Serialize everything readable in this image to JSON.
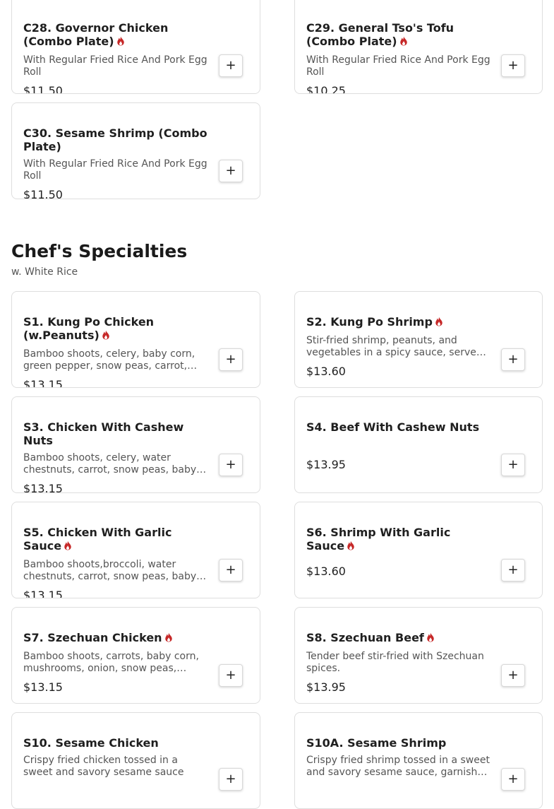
{
  "colors": {
    "spicy": "#c62828",
    "border": "#dedede",
    "text": "#1f1f1f",
    "muted": "#555555"
  },
  "add_button": {
    "label": "+",
    "icon": "plus-icon"
  },
  "combo": {
    "items": [
      {
        "title": "C28. Governor Chicken (Combo Plate)",
        "spicy": true,
        "desc": "With Regular Fried Rice And Pork Egg Roll",
        "price": "$11.50"
      },
      {
        "title": "C29. General Tso's Tofu (Combo Plate)",
        "spicy": true,
        "desc": "With Regular Fried Rice And Pork Egg Roll",
        "price": "$10.25"
      },
      {
        "title": "C30. Sesame Shrimp (Combo Plate)",
        "spicy": false,
        "desc": "With Regular Fried Rice And Pork Egg Roll",
        "price": "$11.50"
      }
    ]
  },
  "chef": {
    "title": "Chef's Specialties",
    "subtitle": "w. White Rice",
    "items": [
      {
        "title": "S1. Kung Po Chicken (w.Peanuts)",
        "spicy": true,
        "desc": "Bamboo shoots, celery, baby corn, green pepper, snow peas, carrot, and peanuts in a spicy sauce",
        "price": "$13.15"
      },
      {
        "title": "S2. Kung Po Shrimp",
        "spicy": true,
        "desc": "Stir-fried shrimp, peanuts, and vegetables in a spicy sauce, served with white rice",
        "price": "$13.60"
      },
      {
        "title": "S3. Chicken With Cashew Nuts",
        "spicy": false,
        "desc": "Bamboo shoots, celery, water chestnuts, carrot, snow peas, baby corn and cashew nuts",
        "price": "$13.15"
      },
      {
        "title": "S4. Beef With Cashew Nuts",
        "spicy": false,
        "desc": "",
        "price": "$13.95"
      },
      {
        "title": "S5. Chicken With Garlic Sauce",
        "spicy": true,
        "desc": "Bamboo shoots,broccoli, water chestnuts, carrot, snow peas, baby corn in garlic sauce",
        "price": "$13.15"
      },
      {
        "title": "S6. Shrimp With Garlic Sauce",
        "spicy": true,
        "desc": "",
        "price": "$13.60"
      },
      {
        "title": "S7. Szechuan Chicken",
        "spicy": true,
        "desc": "Bamboo shoots, carrots, baby corn, mushrooms, onion, snow peas, green pepper in Szechuan sauce",
        "price": "$13.15"
      },
      {
        "title": "S8. Szechuan Beef",
        "spicy": true,
        "desc": "Tender beef stir-fried with Szechuan spices.",
        "price": "$13.95"
      },
      {
        "title": "S10. Sesame Chicken",
        "spicy": false,
        "desc": "Crispy fried chicken tossed in a sweet and savory sesame sauce",
        "price": ""
      },
      {
        "title": "S10A. Sesame Shrimp",
        "spicy": false,
        "desc": "Crispy fried shrimp tossed in a sweet and savory sesame sauce, garnished with sesame seeds",
        "price": ""
      }
    ]
  }
}
